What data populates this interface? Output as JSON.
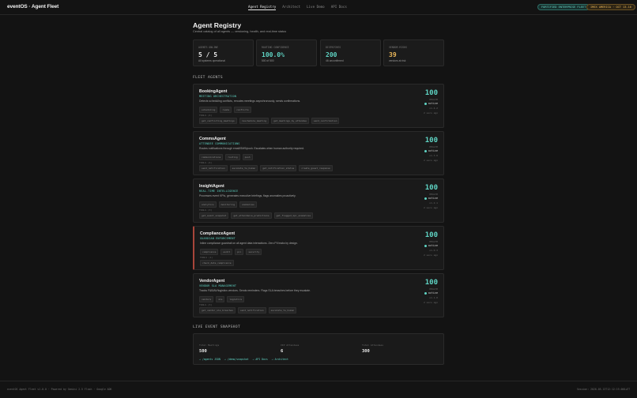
{
  "brand": "eventOS · Agent Fleet",
  "nav": [
    {
      "label": "Agent Registry",
      "active": true
    },
    {
      "label": "Architect",
      "active": false
    },
    {
      "label": "Live Demo",
      "active": false
    },
    {
      "label": "API Docs",
      "active": false
    }
  ],
  "badges": {
    "env": "FORTIFIED ENTERPRISE FLEET",
    "event": "IMEX AMERICA · OCT 13-16"
  },
  "header": {
    "title": "Agent Registry",
    "subtitle": "Central catalog of all agents — versioning, health, and real-time status"
  },
  "stats": [
    {
      "label": "AGENTS ONLINE",
      "value": "5 / 5",
      "sub": "All systems operational",
      "color": "#e8e8e8"
    },
    {
      "label": "ROUTING CONFIDENCE",
      "value": "100.0%",
      "sub": "500 of 500",
      "color": "#5fd4c4"
    },
    {
      "label": "DISPATCHES",
      "value": "200",
      "sub": "46 unconfirmed",
      "color": "#5fd4c4"
    },
    {
      "label": "VENDOR RISKS",
      "value": "39",
      "sub": "vendors at risk",
      "color": "#e7b458"
    }
  ],
  "fleet_title": "FLEET AGENTS",
  "tools_label": "TOOLS (4)",
  "score_label": "HEALTH",
  "agents": [
    {
      "name": "BookingAgent",
      "role": "MEETING ORCHESTRATION",
      "desc": "Detects scheduling conflicts, reroutes meetings asynchronously, sends confirmations.",
      "tags": [
        "scheduling",
        "rooms",
        "conflicts"
      ],
      "tools": [
        "get_conflicting_meetings",
        "reschedule_meeting",
        "get_meetings_by_attendee",
        "send_confirmation"
      ],
      "score": "100",
      "status": "active",
      "version": "v1.4.2",
      "seen": "2 secs ago",
      "alert": false
    },
    {
      "name": "CommsAgent",
      "role": "ATTENDEE COMMUNICATIONS",
      "desc": "Routes notifications through email/SMS/push. Escalates when human authority required.",
      "tags": [
        "communications",
        "routing",
        "push"
      ],
      "tools": [
        "send_notification",
        "escalate_to_human",
        "get_notification_status",
        "create_guest_response"
      ],
      "score": "100",
      "status": "active",
      "version": "v1.3.0",
      "seen": "2 secs ago",
      "alert": false
    },
    {
      "name": "InsightAgent",
      "role": "REAL-TIME INTELLIGENCE",
      "desc": "Processes event KPIs, generates executive briefings, flags anomalies proactively.",
      "tags": [
        "analytics",
        "monitoring",
        "anomalies"
      ],
      "tools": [
        "get_event_snapshot",
        "get_attendance_predictions",
        "get_flagged_kpi_anomalies"
      ],
      "score": "100",
      "status": "active",
      "version": "v1.2.1",
      "seen": "2 secs ago",
      "alert": false
    },
    {
      "name": "ComplianceAgent",
      "role": "GUARDIAN ENFORCEMENT",
      "desc": "Inline compliance guardrail on all agent data interactions. Zero PII leaks by design.",
      "tags": [
        "compliance",
        "audit",
        "pii",
        "security"
      ],
      "tools": [
        "check_data_compliance"
      ],
      "score": "100",
      "status": "active",
      "version": "v1.0.3",
      "seen": "2 secs ago",
      "alert": true
    },
    {
      "name": "VendorAgent",
      "role": "VENDOR SLA MANAGEMENT",
      "desc": "Tracks F&B/AV/logistics vendors. Sends reminders. Flags SLA breaches before they escalate.",
      "tags": [
        "vendors",
        "sla",
        "logistics"
      ],
      "tools": [
        "get_vendor_sla_breaches",
        "send_notification",
        "escalate_to_human"
      ],
      "score": "100",
      "status": "active",
      "version": "v1.1.0",
      "seen": "2 secs ago",
      "alert": false
    }
  ],
  "snapshot": {
    "title": "LIVE EVENT SNAPSHOT",
    "cols": [
      {
        "label": "Total Meetings",
        "value": "500"
      },
      {
        "label": "VIP Attendees",
        "value": "6"
      },
      {
        "label": "Total Attendees",
        "value": "300"
      }
    ],
    "links": [
      "→ /agents JSON",
      "→ /demo/snapshot",
      "→ API Docs",
      "→ Architect"
    ]
  },
  "footer": {
    "left": "eventOS Agent Fleet v1.0.0 · Powered by Gemini 2.5 Flash · Google ADK",
    "right": "Session: 2026-05-13T12:12:19.000+ET"
  }
}
